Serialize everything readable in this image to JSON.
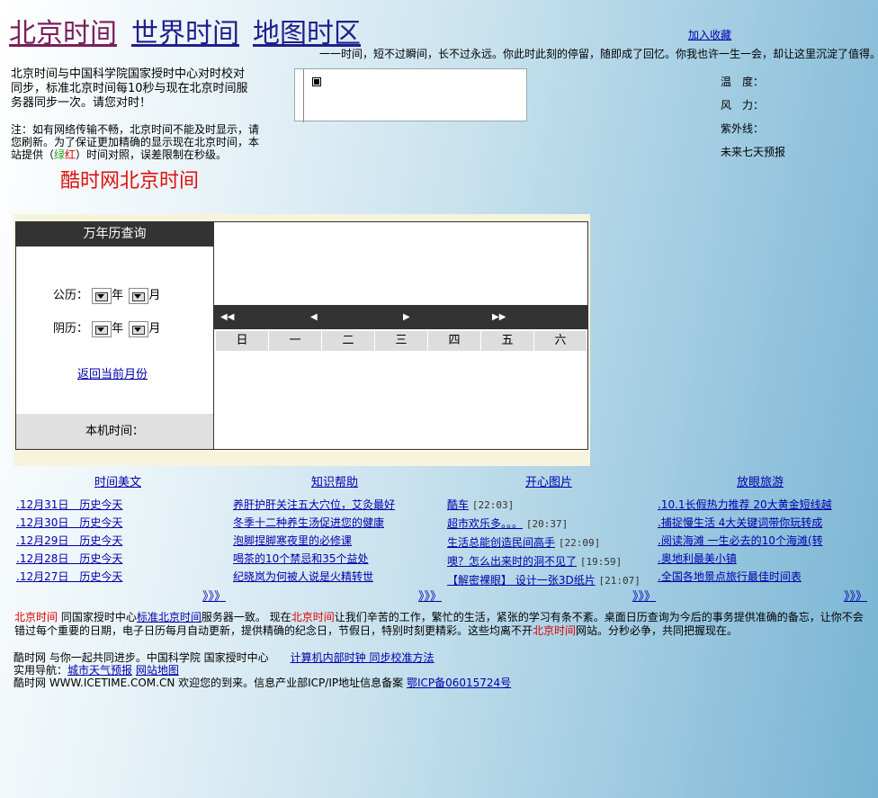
{
  "nav": [
    "北京时间",
    "世界时间",
    "地图时区"
  ],
  "favorite": "加入收藏",
  "motto": "一一时间，短不过瞬间，长不过永远。你此时此刻的停留，随即成了回忆。你我也许一生一会，却让这里沉淀了值得。",
  "intro": "北京时间与中国科学院国家授时中心对时校对同步，标准北京时间每10秒与现在北京时间服务器同步一次。请您对时！",
  "note": {
    "a": "注：如有网络传输不畅，北京时间不能及时显示，请您刷新。为了保证更加精确的显示现在北京时间，本站提供（",
    "green": "绿",
    "red": "红",
    "b": "）时间对照，误差限制在秒级。"
  },
  "brand": "酷时网北京时间",
  "weather": {
    "temp": "温　度：",
    "wind": "风　力：",
    "uv": "紫外线：",
    "forecast": "未来七天预报"
  },
  "calendar": {
    "title": "万年历查询",
    "solar": "公历：",
    "lunar": "阴历：",
    "year": "年",
    "month": "月",
    "back": "返回当前月份",
    "local": "本机时间：",
    "weekdays": [
      "日",
      "一",
      "二",
      "三",
      "四",
      "五",
      "六"
    ]
  },
  "sections": {
    "s1": {
      "title": "时间美文",
      "items": [
        ".12月31日　历史今天",
        ".12月30日　历史今天",
        ".12月29日　历史今天",
        ".12月28日　历史今天",
        ".12月27日　历史今天"
      ]
    },
    "s2": {
      "title": "知识帮助",
      "items": [
        "养肝护肝关注五大穴位，艾灸最好",
        "冬季十二种养生汤促进您的健康",
        "泡脚捏脚寒夜里的必修课",
        "喝茶的10个禁忌和35个益处",
        "纪晓岚为何被人说是火精转世"
      ]
    },
    "s3": {
      "title": "开心图片",
      "items": [
        {
          "text": "酷车",
          "time": "[22:03]"
        },
        {
          "text": "超市欢乐多。。。",
          "time": "[20:37]"
        },
        {
          "text": "生活总能创造民间高手",
          "time": "[22:09]"
        },
        {
          "text": "噢？怎么出来时的洞不见了",
          "time": "[19:59]"
        },
        {
          "text": "【解密裸眼】 设计一张3D纸片",
          "time": "[21:07]"
        }
      ]
    },
    "s4": {
      "title": "放眼旅游",
      "items": [
        ".10.1长假热力推荐 20大黄金短线越",
        ".捕捉慢生活 4大关键词带你玩转成",
        ".阅读海滩 一生必去的10个海滩(转",
        ".奥地利最美小镇",
        ".全国各地景点旅行最佳时间表"
      ]
    },
    "more": "》》》"
  },
  "para": {
    "a": "北京时间",
    "b": " 同国家授时中心",
    "link": "标准北京时间",
    "c": "服务器一致。 现在",
    "d": "北京时间",
    "e": "让我们辛苦的工作，繁忙的生活，紧张的学习有条不紊。桌面日历查询为今后的事务提供准确的备忘，让你不会错过每个重要的日期，电子日历每月自动更新，提供精确的纪念日，节假日，特别时刻更精彩。这些均离不开",
    "f": "北京时间",
    "g": "网站。分秒必争，共同把握现在。"
  },
  "footer": {
    "l1": "酷时网 与你一起共同进步。中国科学院 国家授时中心",
    "l1link": "计算机内部时钟 同步校准方法",
    "l2": "实用导航：",
    "l2a": "城市天气预报",
    "l2b": "网站地图",
    "l3": "酷时网 WWW.ICETIME.COM.CN 欢迎您的到来。信息产业部ICP/IP地址信息备案",
    "l3link": "鄂ICP备06015724号"
  }
}
